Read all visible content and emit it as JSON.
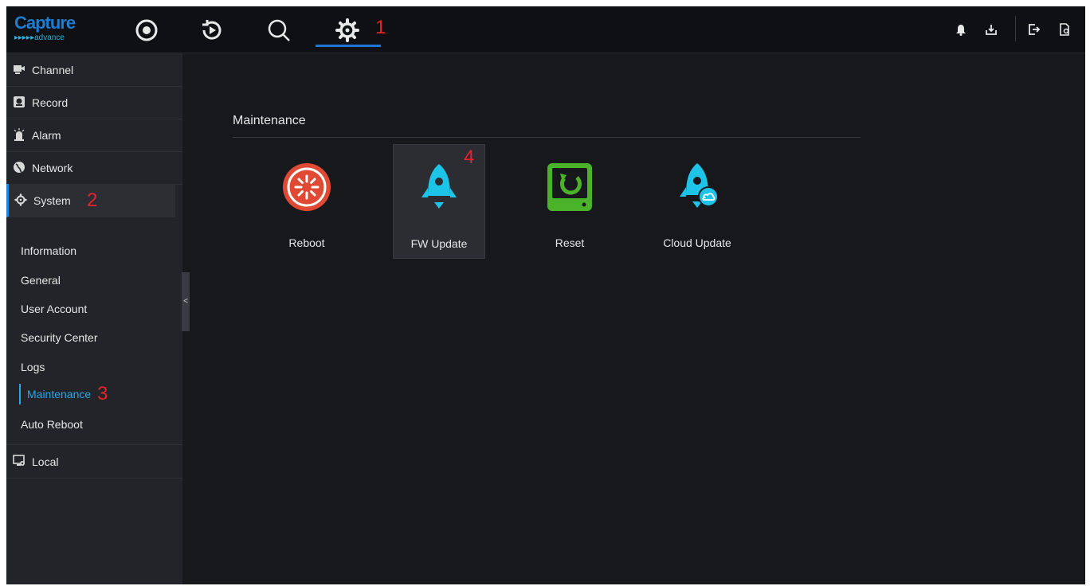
{
  "brand": {
    "name": "Capture",
    "tagline": "advance"
  },
  "topnav": {
    "icons": [
      "live-view-icon",
      "playback-icon",
      "search-icon",
      "settings-gear-icon"
    ],
    "active": "settings-gear-icon",
    "right_icons": [
      "bell-icon",
      "download-icon",
      "logout-icon",
      "lock-screen-icon"
    ]
  },
  "annotations": {
    "a1": "1",
    "a2": "2",
    "a3": "3",
    "a4": "4"
  },
  "sidebar": {
    "items": [
      {
        "label": "Channel",
        "icon": "camera-icon"
      },
      {
        "label": "Record",
        "icon": "record-icon"
      },
      {
        "label": "Alarm",
        "icon": "alarm-icon"
      },
      {
        "label": "Network",
        "icon": "globe-icon"
      },
      {
        "label": "System",
        "icon": "gear-icon"
      }
    ],
    "submenu": [
      "Information",
      "General",
      "User Account",
      "Security Center",
      "Logs",
      "Maintenance",
      "Auto Reboot"
    ],
    "active_submenu": "Maintenance",
    "local": {
      "label": "Local",
      "icon": "monitor-icon"
    },
    "collapse_glyph": "<"
  },
  "main": {
    "section_title": "Maintenance",
    "tiles": [
      {
        "label": "Reboot",
        "icon": "reboot-icon",
        "color": "#e04a34"
      },
      {
        "label": "FW Update",
        "icon": "rocket-icon",
        "color": "#1ec4e8"
      },
      {
        "label": "Reset",
        "icon": "reset-icon",
        "color": "#4ab329"
      },
      {
        "label": "Cloud Update",
        "icon": "cloud-rocket-icon",
        "color": "#1ec4e8"
      }
    ]
  },
  "colors": {
    "accent": "#1f86d9",
    "annotation": "#e5232c",
    "background": "#17181c"
  }
}
